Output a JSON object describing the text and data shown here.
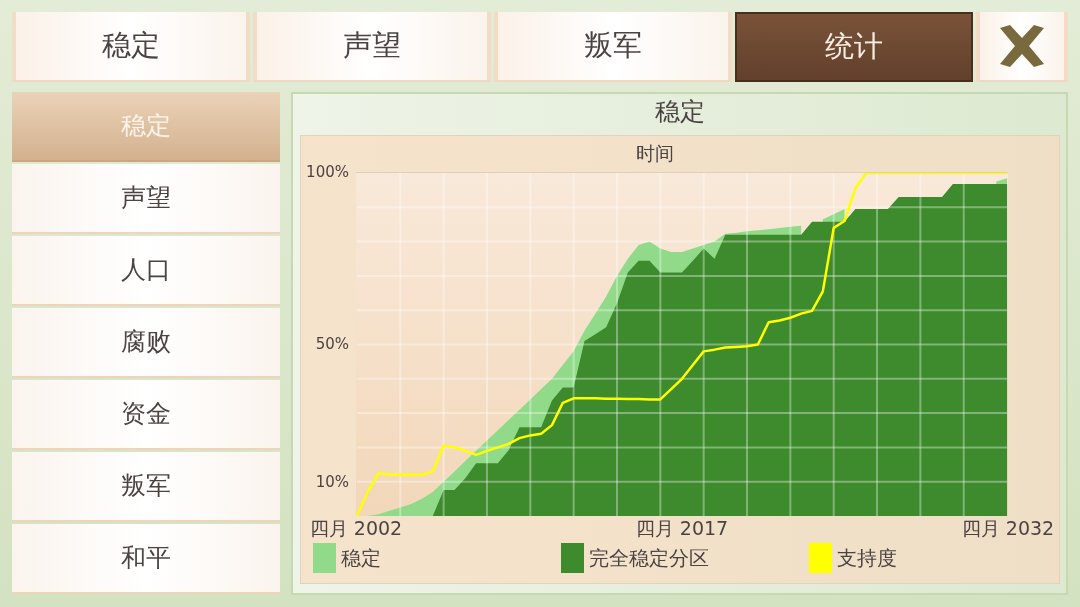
{
  "tabs": [
    {
      "label": "稳定",
      "selected": false
    },
    {
      "label": "声望",
      "selected": false
    },
    {
      "label": "叛军",
      "selected": false
    },
    {
      "label": "统计",
      "selected": true
    }
  ],
  "sidebar": {
    "items": [
      {
        "label": "稳定",
        "selected": true
      },
      {
        "label": "声望",
        "selected": false
      },
      {
        "label": "人口",
        "selected": false
      },
      {
        "label": "腐败",
        "selected": false
      },
      {
        "label": "资金",
        "selected": false
      },
      {
        "label": "叛军",
        "selected": false
      },
      {
        "label": "和平",
        "selected": false
      }
    ]
  },
  "panel": {
    "title": "稳定",
    "chart_data": {
      "type": "area",
      "xlabel": "时间",
      "categories": [
        "四月 2002",
        null,
        null,
        null,
        null,
        null,
        null,
        null,
        null,
        null,
        null,
        null,
        null,
        null,
        null,
        null,
        null,
        null,
        null,
        null,
        null,
        null,
        null,
        null,
        null,
        null,
        null,
        null,
        null,
        null,
        "四月 2017",
        null,
        null,
        null,
        null,
        null,
        null,
        null,
        null,
        null,
        null,
        null,
        null,
        null,
        null,
        null,
        null,
        null,
        null,
        null,
        null,
        null,
        null,
        null,
        null,
        null,
        null,
        null,
        null,
        null,
        "四月 2032"
      ],
      "ylim": [
        0,
        100
      ],
      "yticks": [
        {
          "value": 100,
          "label": "100%"
        },
        {
          "value": 50,
          "label": "50%"
        },
        {
          "value": 10,
          "label": "10%"
        }
      ],
      "legend": "bottom",
      "series": [
        {
          "name": "稳定",
          "type": "area",
          "color": "#90da8a",
          "values": [
            0,
            0,
            0.5,
            1.5,
            2.5,
            3.5,
            5,
            7,
            10,
            13,
            16,
            19,
            22,
            25,
            28,
            31,
            34,
            37,
            40,
            44,
            48,
            54,
            59,
            64,
            70,
            75,
            79,
            80,
            78,
            77,
            77,
            78,
            79,
            80,
            82.3,
            82.6,
            83,
            83.3,
            83.6,
            84,
            84.3,
            84.6,
            null,
            86.5,
            88,
            89.5,
            null,
            null,
            null,
            null,
            null,
            null,
            null,
            null,
            null,
            null,
            null,
            null,
            null,
            97.5,
            98.5
          ]
        },
        {
          "name": "完全稳定分区",
          "type": "area",
          "color": "#3d8b2c",
          "values": [
            0,
            0,
            0,
            0,
            0,
            0,
            0,
            0,
            7.6,
            7.6,
            11,
            15.4,
            15.4,
            15.4,
            19.2,
            25.9,
            25.9,
            25.9,
            33.7,
            37.5,
            37.5,
            51,
            53,
            55,
            62,
            71,
            74.4,
            74.4,
            71,
            71,
            71,
            74.4,
            78,
            75,
            82,
            82,
            82,
            82,
            82,
            82,
            82,
            82,
            85.8,
            85.8,
            85.8,
            85.8,
            89.5,
            89.5,
            89.5,
            89.5,
            93,
            93,
            93,
            93,
            93,
            96.8,
            96.8,
            96.8,
            96.8,
            96.8,
            96.8
          ]
        },
        {
          "name": "支持度",
          "type": "line",
          "color": "#ffff00",
          "values": [
            0,
            7,
            12.5,
            12,
            12,
            12,
            12,
            13,
            20.5,
            20,
            19,
            17.8,
            19,
            20,
            21,
            22.7,
            23.5,
            24,
            26.5,
            33,
            34.3,
            34.3,
            34.3,
            34.2,
            34.2,
            34.1,
            34.1,
            34,
            34,
            37,
            40,
            44,
            48,
            48.5,
            49.1,
            49.3,
            49.5,
            50,
            56.5,
            57,
            57.8,
            59,
            59.8,
            65.5,
            84,
            86,
            95.5,
            100,
            100,
            100,
            100,
            100,
            100,
            100,
            100,
            100,
            100,
            100,
            100,
            100,
            100
          ]
        }
      ]
    }
  }
}
